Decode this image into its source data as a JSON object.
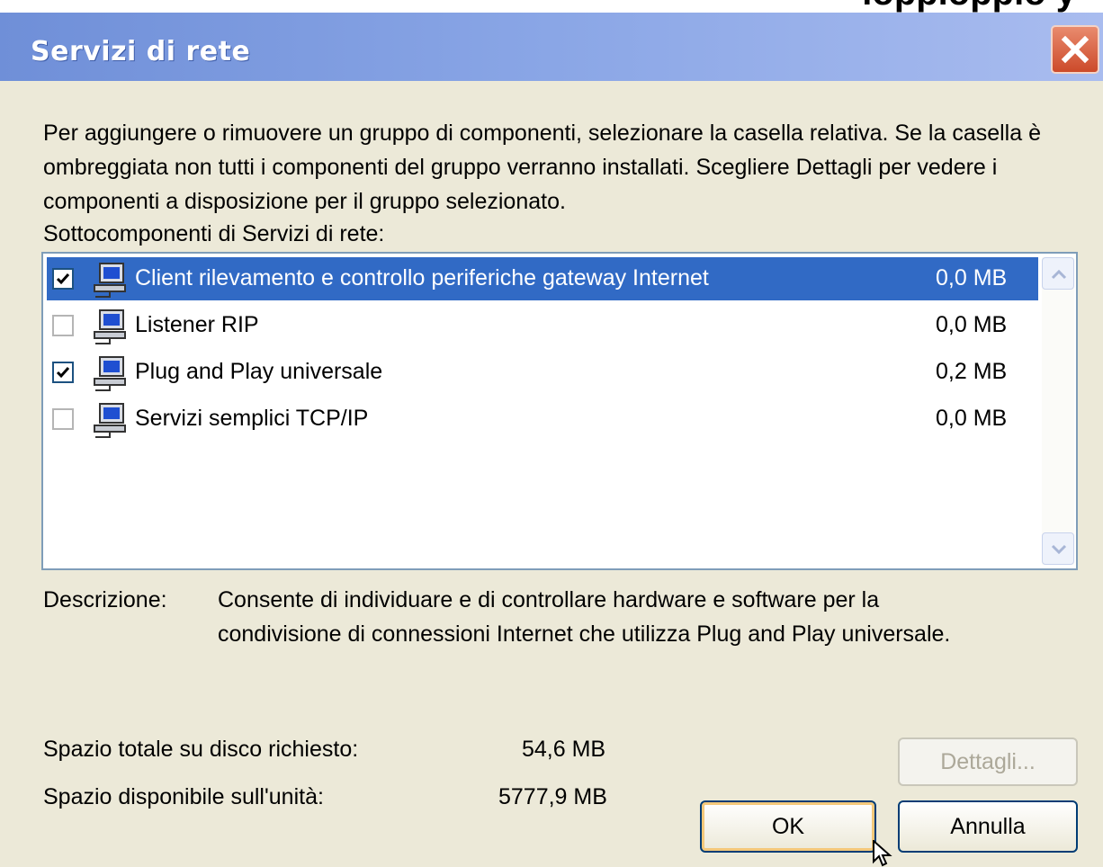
{
  "background_text": "ioppioppio y",
  "window": {
    "title": "Servizi di rete",
    "close_icon": "close-x-icon",
    "close_color": "#d9532f",
    "titlebar_color": "#7d99df"
  },
  "intro_text": "Per aggiungere o rimuovere un gruppo di componenti, selezionare la casella relativa. Se la casella è ombreggiata non tutti i componenti del gruppo verranno installati. Scegliere Dettagli per vedere i componenti a disposizione per il gruppo selezionato.",
  "list_label": "Sottocomponenti di Servizi di rete:",
  "components": [
    {
      "label": "Client rilevamento e controllo periferiche gateway Internet",
      "size": "0,0 MB",
      "checked": true,
      "selected": true,
      "icon": "network-computer-icon"
    },
    {
      "label": "Listener RIP",
      "size": "0,0 MB",
      "checked": false,
      "selected": false,
      "icon": "network-computer-icon"
    },
    {
      "label": "Plug and Play universale",
      "size": "0,2 MB",
      "checked": true,
      "selected": false,
      "icon": "network-computer-icon"
    },
    {
      "label": "Servizi semplici TCP/IP",
      "size": "0,0 MB",
      "checked": false,
      "selected": false,
      "icon": "network-computer-icon"
    }
  ],
  "description": {
    "label": "Descrizione:",
    "line1": "Consente di individuare e di controllare hardware e software per la",
    "line2": "condivisione di connessioni Internet che utilizza Plug and Play universale."
  },
  "disk": {
    "total_label": "Spazio totale su disco richiesto:",
    "total_value": "54,6 MB",
    "available_label": "Spazio disponibile sull'unità:",
    "available_value": "5777,9 MB"
  },
  "buttons": {
    "details": "Dettagli...",
    "ok": "OK",
    "cancel": "Annulla"
  },
  "colors": {
    "selection": "#316ac5",
    "dialog_bg": "#ece9d8"
  }
}
